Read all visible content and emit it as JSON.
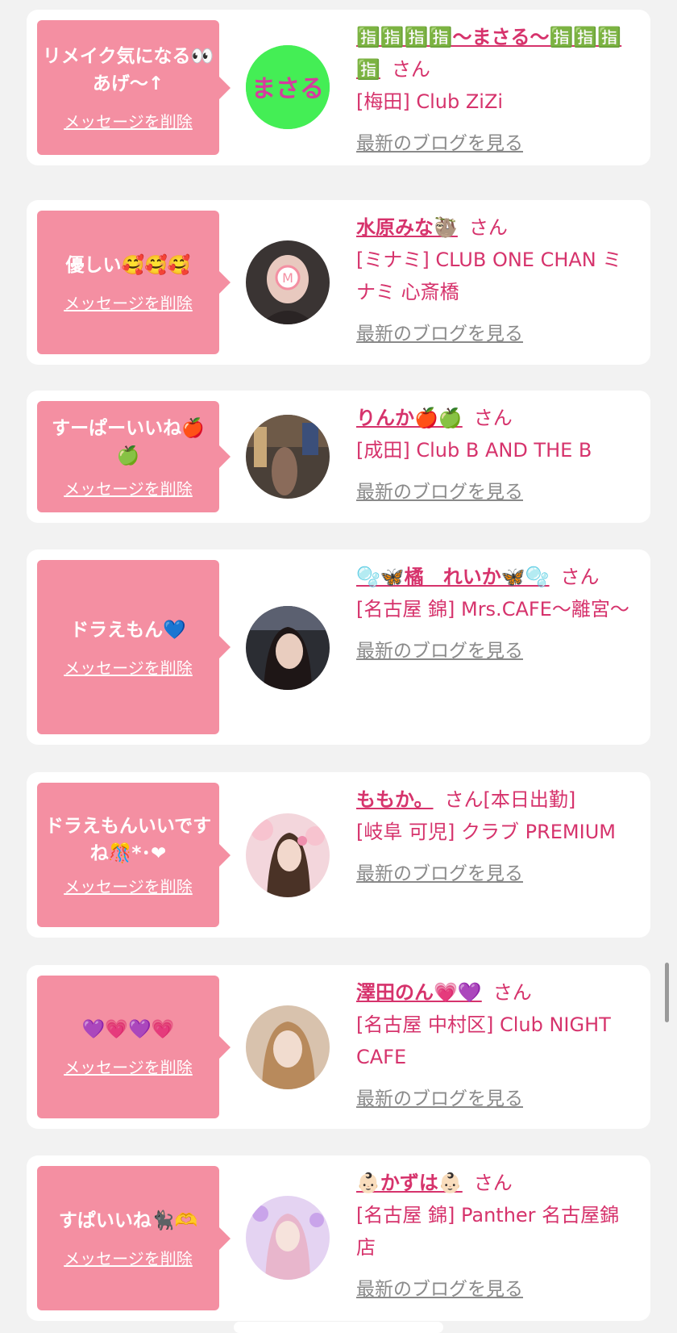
{
  "delete_label": "メッセージを削除",
  "san_label": "さん",
  "blog_label": "最新のブログを見る",
  "colors": {
    "accent": "#d6336c",
    "bubble": "#f48fa2",
    "link_gray": "#8a8a8a"
  },
  "cards": [
    {
      "message": "リメイク気になる👀あげ〜↑",
      "name": "🈯🈯🈯🈯〜まさる〜🈯🈯🈯🈯",
      "status": "",
      "shop": "[梅田] Club ZiZi",
      "avatar_text": "まさる"
    },
    {
      "message": "優しい🥰🥰🥰",
      "name": "水原みな🦥",
      "status": "",
      "shop": "[ミナミ] CLUB ONE CHAN ミナミ 心斎橋",
      "avatar_text": "M"
    },
    {
      "message": "すーぱーいいね🍎🍏",
      "name": "りんか🍎🍏",
      "status": "",
      "shop": "[成田] Club B AND THE B",
      "avatar_text": ""
    },
    {
      "message": "ドラえもん💙",
      "name": "🫧🦋橘　れいか🦋🫧",
      "status": "",
      "shop": "[名古屋 錦] Mrs.CAFE〜離宮〜",
      "avatar_text": ""
    },
    {
      "message": "ドラえもんいいですね🎊*･❤",
      "name": "ももか。",
      "status": "[本日出勤]",
      "shop": "[岐阜 可児] クラブ PREMIUM",
      "avatar_text": ""
    },
    {
      "message": "💜💗💜💗",
      "name": "澤田のん💗💜",
      "status": "",
      "shop": "[名古屋 中村区] Club NIGHT CAFE",
      "avatar_text": ""
    },
    {
      "message": "すぱいいね🐈‍⬛🫶",
      "name": "👶🏻かずは👶🏻",
      "status": "",
      "shop": "[名古屋 錦] Panther 名古屋錦店",
      "avatar_text": ""
    }
  ]
}
